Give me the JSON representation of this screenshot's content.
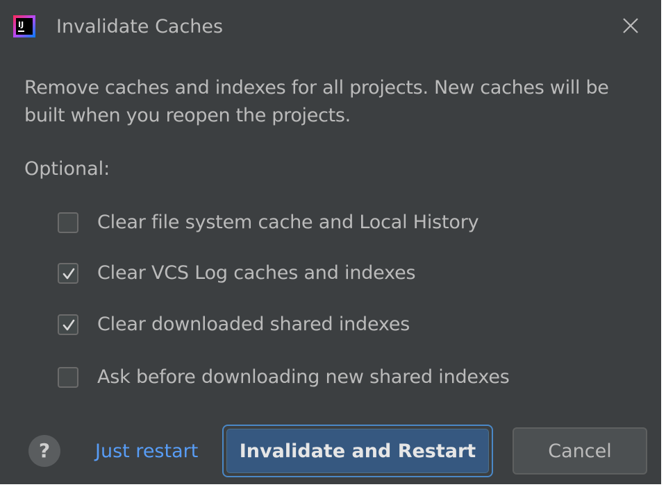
{
  "dialog": {
    "title": "Invalidate Caches",
    "app_icon_text": "IJ",
    "description_line1": "Remove caches and indexes for all projects. New caches will be",
    "description_line2": "built when you reopen the projects.",
    "optional_label": "Optional:"
  },
  "options": [
    {
      "label": "Clear file system cache and Local History",
      "checked": false
    },
    {
      "label": "Clear VCS Log caches and indexes",
      "checked": true
    },
    {
      "label": "Clear downloaded shared indexes",
      "checked": true
    },
    {
      "label": "Ask before downloading new shared indexes",
      "checked": false
    }
  ],
  "footer": {
    "help_label": "?",
    "just_restart_label": "Just restart",
    "primary_label": "Invalidate and Restart",
    "cancel_label": "Cancel"
  },
  "colors": {
    "background": "#3c3f41",
    "text": "#bbbbbb",
    "link": "#589df6",
    "primary": "#365880",
    "focus_ring": "#4a88c7"
  }
}
